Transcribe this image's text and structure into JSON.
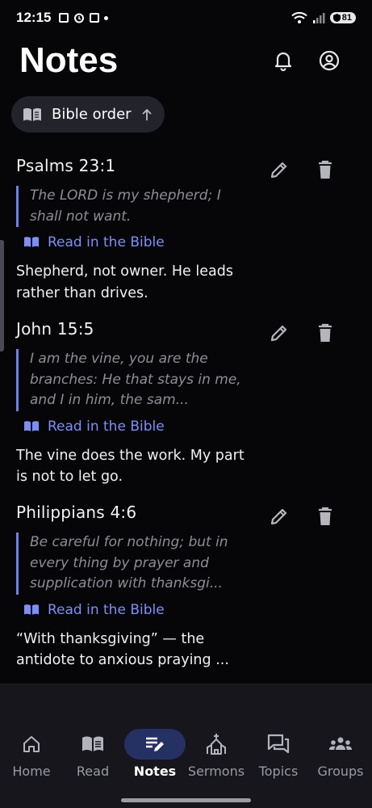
{
  "status_bar": {
    "time": "12:15",
    "battery": "81",
    "icons": [
      "outlook-icon",
      "alarm-icon",
      "calendar-icon",
      "dot-icon",
      "wifi-icon",
      "signal-icon",
      "battery-icon"
    ]
  },
  "header": {
    "title": "Notes",
    "icons": [
      "bell-icon",
      "account-icon"
    ]
  },
  "sort": {
    "label": "Bible order",
    "icon": "book-open-icon",
    "direction_icon": "arrow-up-icon"
  },
  "notes": [
    {
      "reference": "Psalms 23:1",
      "verse": "The LORD is my shepherd; I shall not want.",
      "link": "Read in the Bible",
      "body": "Shepherd, not owner. He leads rather than drives."
    },
    {
      "reference": "John 15:5",
      "verse": "I am the vine, you are the branches: He that stays in me, and I in him, the sam...",
      "link": "Read in the Bible",
      "body": "The vine does the work. My part is not to let go."
    },
    {
      "reference": "Philippians 4:6",
      "verse": "Be careful for nothing; but in every thing by prayer and supplication with thanksgi...",
      "link": "Read in the Bible",
      "body": "“With thanksgiving” — the antidote to anxious praying ..."
    }
  ],
  "bottom_nav": {
    "items": [
      {
        "label": "Home",
        "icon": "home-icon"
      },
      {
        "label": "Read",
        "icon": "book-icon"
      },
      {
        "label": "Notes",
        "icon": "notes-edit-icon",
        "active": true
      },
      {
        "label": "Sermons",
        "icon": "church-icon"
      },
      {
        "label": "Topics",
        "icon": "forum-icon"
      },
      {
        "label": "Groups",
        "icon": "groups-icon"
      }
    ]
  },
  "colors": {
    "background": "#060608",
    "accent": "#7d8ff6",
    "verse_bar": "#6e7ff0",
    "active_nav_pill": "#253063",
    "chip": "#22232b"
  }
}
